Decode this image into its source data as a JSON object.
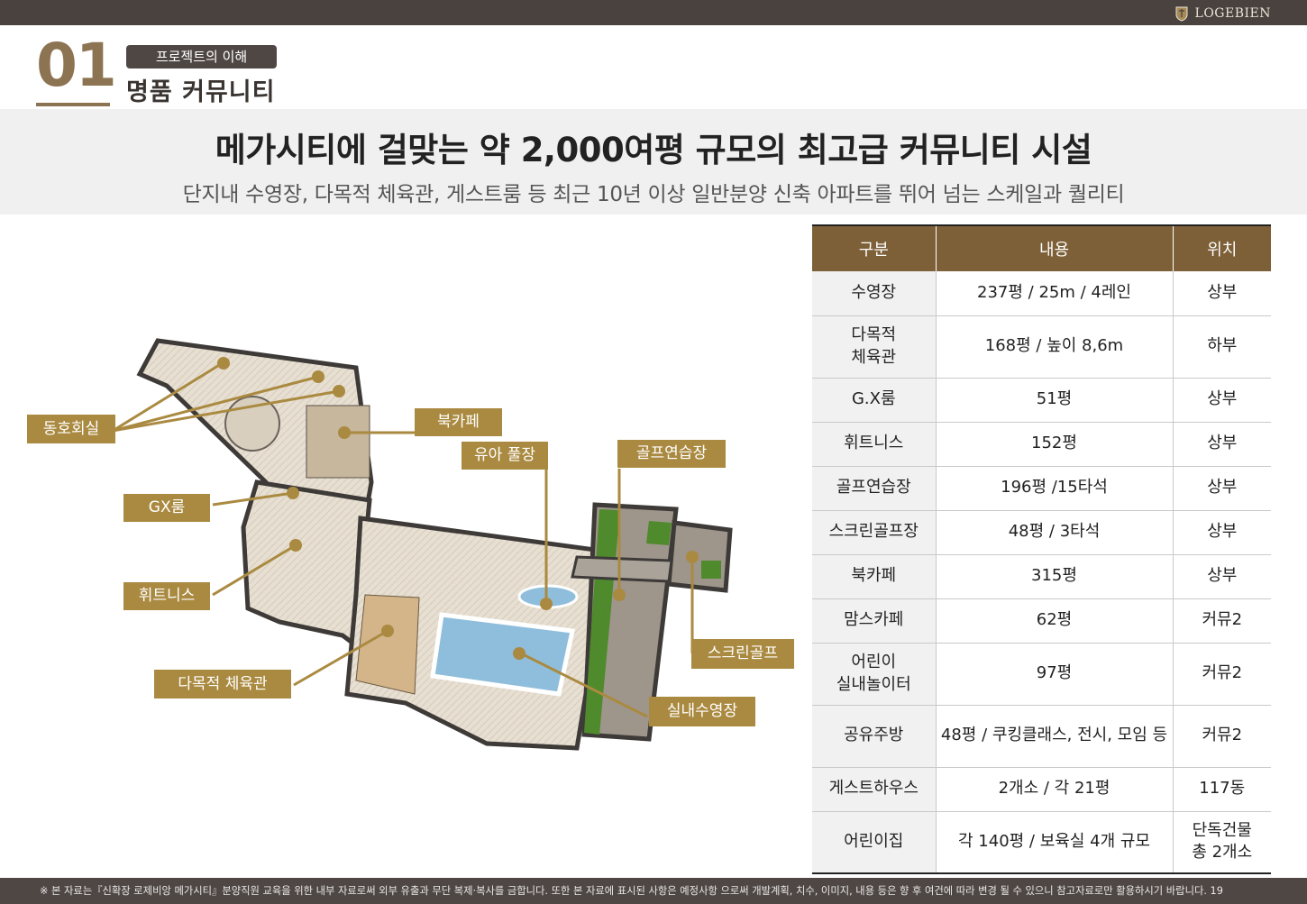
{
  "header": {
    "brand": "LOGEBIEN"
  },
  "section": {
    "number": "01",
    "tag": "프로젝트의 이해",
    "title": "명품  커뮤니티"
  },
  "headline": "메가시티에 걸맞는 약 2,000여평 규모의 최고급 커뮤니티 시설",
  "subline": "단지내 수영장, 다목적 체육관, 게스트룸 등 최근 10년 이상 일반분양 신축 아파트를 뛰어 넘는 스케일과 퀄리티",
  "map_labels": {
    "donghohoesil": "동호회실",
    "bookcafe": "북카페",
    "kidspool": "유아 풀장",
    "golfrange": "골프연습장",
    "gxroom": "GX룸",
    "fitness": "휘트니스",
    "gym": "다목적 체육관",
    "screengolf": "스크린골프",
    "indoorpool": "실내수영장"
  },
  "colors": {
    "accent": "#aa8a40",
    "table_header": "#7d6038",
    "dark": "#4f4744"
  },
  "table": {
    "headers": [
      "구분",
      "내용",
      "위치"
    ],
    "rows": [
      {
        "name": [
          "수영장"
        ],
        "content": "237평 / 25m / 4레인",
        "location": [
          "상부"
        ]
      },
      {
        "name": [
          "다목적",
          "체육관"
        ],
        "content": "168평 / 높이 8,6m",
        "location": [
          "하부"
        ]
      },
      {
        "name": [
          "G.X룸"
        ],
        "content": "51평",
        "location": [
          "상부"
        ]
      },
      {
        "name": [
          "휘트니스"
        ],
        "content": "152평",
        "location": [
          "상부"
        ]
      },
      {
        "name": [
          "골프연습장"
        ],
        "content": "196평 /15타석",
        "location": [
          "상부"
        ]
      },
      {
        "name": [
          "스크린골프장"
        ],
        "content": "48평 / 3타석",
        "location": [
          "상부"
        ]
      },
      {
        "name": [
          "북카페"
        ],
        "content": "315평",
        "location": [
          "상부"
        ]
      },
      {
        "name": [
          "맘스카페"
        ],
        "content": "62평",
        "location": [
          "커뮤2"
        ]
      },
      {
        "name": [
          "어린이",
          "실내놀이터"
        ],
        "content": "97평",
        "location": [
          "커뮤2"
        ]
      },
      {
        "name": [
          "공유주방"
        ],
        "content": "48평 / 쿠킹클래스, 전시, 모임 등",
        "location": [
          "커뮤2"
        ]
      },
      {
        "name": [
          "게스트하우스"
        ],
        "content": "2개소 / 각 21평",
        "location": [
          "117동"
        ]
      },
      {
        "name": [
          "어린이집"
        ],
        "content": "각 140평 / 보육실 4개 규모",
        "location": [
          "단독건물",
          "총 2개소"
        ]
      }
    ]
  },
  "footer": "※ 본 자료는『신확장 로제비앙 메가시티』분양직원 교육을 위한 내부 자료로써 외부 유출과 무단 복제·복사를 금합니다. 또한 본 자료에 표시된 사항은 예정사항 으로써 개발계획, 치수, 이미지, 내용 등은 향 후 여건에 따라 변경 될 수 있으니 참고자료로만 활용하시기 바랍니다. 19"
}
